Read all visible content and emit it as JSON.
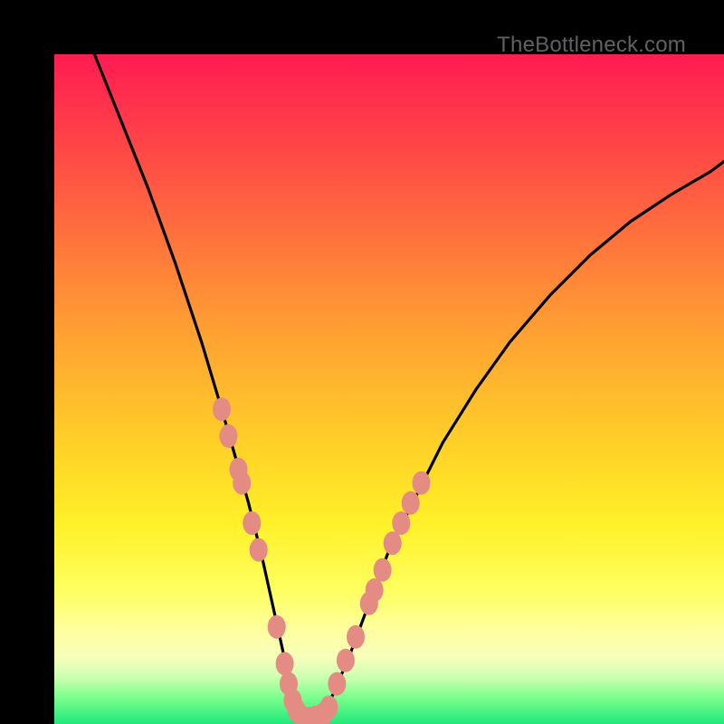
{
  "watermark": "TheBottleneck.com",
  "chart_data": {
    "type": "line",
    "title": "",
    "xlabel": "",
    "ylabel": "",
    "xlim": [
      0,
      100
    ],
    "ylim": [
      0,
      100
    ],
    "series": [
      {
        "name": "curve",
        "x": [
          6,
          10,
          14,
          18,
          22,
          25,
          27,
          29,
          31,
          33,
          35,
          36,
          37.5,
          41,
          44,
          47,
          50,
          54,
          58,
          63,
          68,
          74,
          80,
          86,
          92,
          98,
          100
        ],
        "y": [
          100,
          90,
          80,
          69,
          57,
          47,
          40,
          33,
          25,
          16,
          7,
          2,
          0.5,
          3,
          10,
          18,
          26,
          34,
          42,
          50,
          57,
          64,
          70,
          75,
          79,
          82.5,
          84
        ]
      }
    ],
    "markers": {
      "name": "highlight-dots",
      "color": "#e48b84",
      "points": [
        {
          "x": 25.0,
          "y": 47
        },
        {
          "x": 26.0,
          "y": 43
        },
        {
          "x": 27.5,
          "y": 38
        },
        {
          "x": 28.0,
          "y": 36
        },
        {
          "x": 29.5,
          "y": 30
        },
        {
          "x": 30.5,
          "y": 26
        },
        {
          "x": 33.2,
          "y": 14.5
        },
        {
          "x": 34.4,
          "y": 9
        },
        {
          "x": 35.0,
          "y": 6
        },
        {
          "x": 35.6,
          "y": 3.5
        },
        {
          "x": 36.2,
          "y": 2
        },
        {
          "x": 37.0,
          "y": 1
        },
        {
          "x": 38.0,
          "y": 0.8
        },
        {
          "x": 39.0,
          "y": 1
        },
        {
          "x": 40.2,
          "y": 1.5
        },
        {
          "x": 41.0,
          "y": 2.5
        },
        {
          "x": 42.2,
          "y": 6
        },
        {
          "x": 43.5,
          "y": 9.5
        },
        {
          "x": 45.0,
          "y": 13
        },
        {
          "x": 47.0,
          "y": 18
        },
        {
          "x": 47.8,
          "y": 20
        },
        {
          "x": 49.0,
          "y": 23
        },
        {
          "x": 50.5,
          "y": 27
        },
        {
          "x": 51.8,
          "y": 30
        },
        {
          "x": 53.2,
          "y": 33
        },
        {
          "x": 54.8,
          "y": 36
        }
      ]
    },
    "gradient_stops": [
      {
        "pos": 0,
        "color": "#ff1c52"
      },
      {
        "pos": 25,
        "color": "#ff6a3e"
      },
      {
        "pos": 58,
        "color": "#ffd028"
      },
      {
        "pos": 80,
        "color": "#ffff60"
      },
      {
        "pos": 100,
        "color": "#1fe87c"
      }
    ]
  }
}
